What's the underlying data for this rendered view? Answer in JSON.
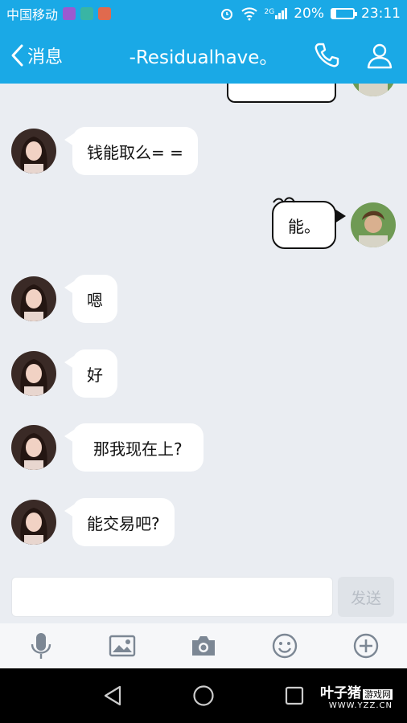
{
  "status_bar": {
    "carrier": "中国移动",
    "network": "2G",
    "battery": "20%",
    "time": "23:11"
  },
  "header": {
    "back_label": "消息",
    "title": "-Residualhave。"
  },
  "messages": [
    {
      "side": "left",
      "text": "钱能取么= ="
    },
    {
      "side": "right",
      "text": "能。"
    },
    {
      "side": "left",
      "text": "嗯"
    },
    {
      "side": "left",
      "text": "好"
    },
    {
      "side": "left",
      "text": "那我现在上?"
    },
    {
      "side": "left",
      "text": "能交易吧?"
    }
  ],
  "input": {
    "value": "",
    "send_label": "发送"
  },
  "toolbar": {
    "items": [
      "microphone-icon",
      "image-icon",
      "camera-icon",
      "emoji-icon",
      "plus-icon"
    ]
  },
  "watermark": {
    "brand": "叶子猪",
    "tag": "游戏网",
    "url": "WWW.YZZ.CN"
  },
  "colors": {
    "accent": "#1aa9e6",
    "background": "#eaedf2"
  }
}
